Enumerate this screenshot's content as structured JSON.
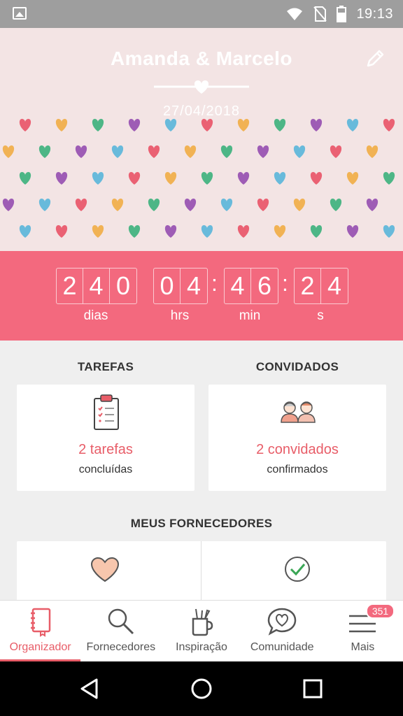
{
  "status_bar": {
    "time": "19:13"
  },
  "header": {
    "couple_names": "Amanda & Marcelo",
    "wedding_date": "27/04/2018"
  },
  "countdown": {
    "days_digits": [
      "2",
      "4",
      "0"
    ],
    "hours_digits": [
      "0",
      "4"
    ],
    "minutes_digits": [
      "4",
      "6"
    ],
    "seconds_digits": [
      "2",
      "4"
    ],
    "separator": ":",
    "days_label": "dias",
    "hours_label": "hrs",
    "minutes_label": "min",
    "seconds_label": "s"
  },
  "tasks": {
    "title": "TAREFAS",
    "count_text": "2 tarefas",
    "status_text": "concluídas"
  },
  "guests": {
    "title": "CONVIDADOS",
    "count_text": "2 convidados",
    "status_text": "confirmados"
  },
  "suppliers": {
    "title": "MEUS FORNECEDORES"
  },
  "tabs": [
    {
      "label": "Organizador",
      "icon": "notebook-icon",
      "active": true
    },
    {
      "label": "Fornecedores",
      "icon": "magnifier-icon"
    },
    {
      "label": "Inspiração",
      "icon": "brush-cup-icon"
    },
    {
      "label": "Comunidade",
      "icon": "chat-heart-icon"
    },
    {
      "label": "Mais",
      "icon": "menu-icon",
      "badge": "351"
    }
  ],
  "colors": {
    "accent": "#f3697e",
    "accent_text": "#e85d68",
    "header_bg": "#f3e4e4"
  }
}
